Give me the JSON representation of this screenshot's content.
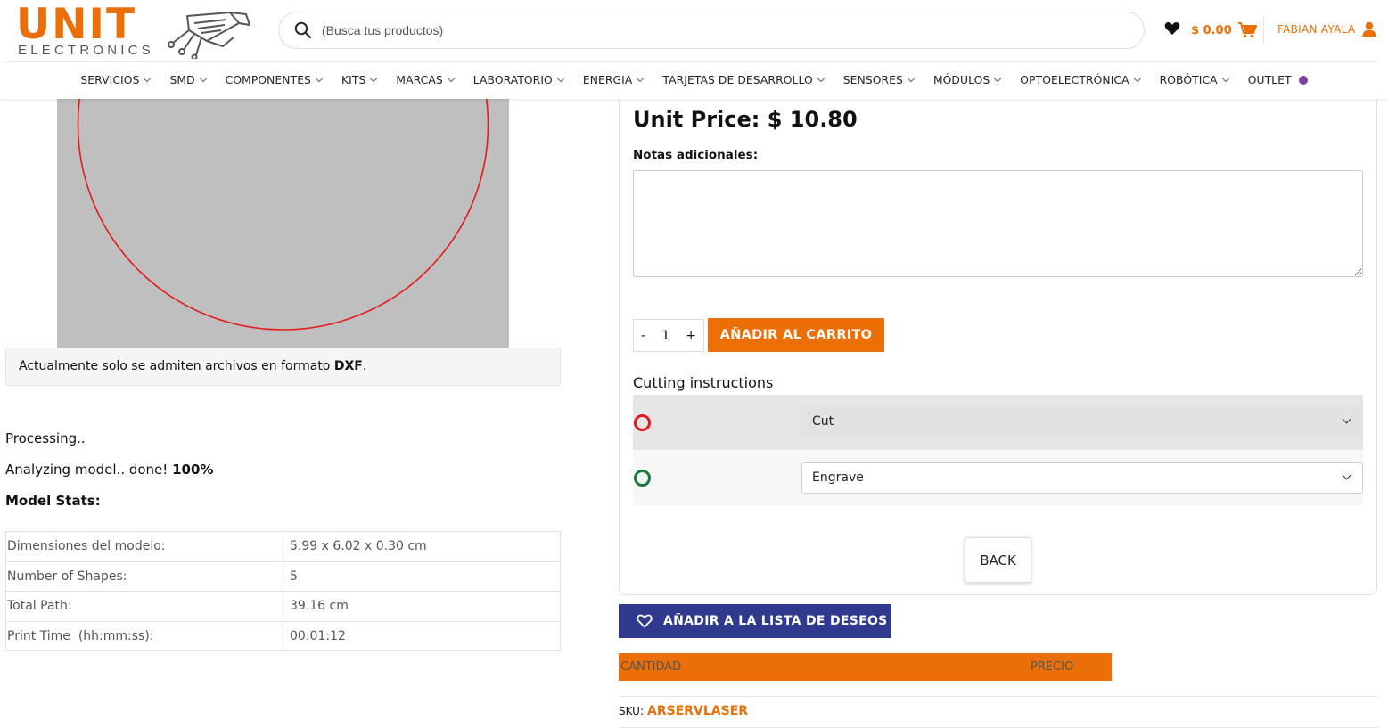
{
  "brand": {
    "name_top": "UNIT",
    "name_bottom": "ELECTRONICS",
    "accent": "#ec6e07",
    "logo_graphic": "circuit-connector-graphic"
  },
  "search": {
    "placeholder": "(Busca tus productos)",
    "icon": "search-icon"
  },
  "header": {
    "wishlist_icon": "heart-icon",
    "cart_total": "$ 0.00",
    "cart_icon": "cart-icon",
    "account_name": "FABIAN AYALA",
    "account_icon": "user-icon"
  },
  "nav": {
    "items": [
      {
        "label": "SERVICIOS",
        "dropdown": true
      },
      {
        "label": "SMD",
        "dropdown": true
      },
      {
        "label": "COMPONENTES",
        "dropdown": true
      },
      {
        "label": "KITS",
        "dropdown": true
      },
      {
        "label": "MARCAS",
        "dropdown": true
      },
      {
        "label": "LABORATORIO",
        "dropdown": true
      },
      {
        "label": "ENERGIA",
        "dropdown": true
      },
      {
        "label": "TARJETAS DE DESARROLLO",
        "dropdown": true
      },
      {
        "label": "SENSORES",
        "dropdown": true
      },
      {
        "label": "MÓDULOS",
        "dropdown": true
      },
      {
        "label": "OPTOELECTRÓNICA",
        "dropdown": true
      },
      {
        "label": "ROBÓTICA",
        "dropdown": true
      },
      {
        "label": "OUTLET",
        "dropdown": false
      }
    ]
  },
  "left": {
    "preview_bg": "#bfbfbf",
    "shape_color": "#e31b1b",
    "notice_text": "Actualmente solo se admiten archivos en formato ",
    "notice_format": "DXF",
    "notice_end": ".",
    "processing": "Processing..",
    "analyzing": "Analyzing model.. done! ",
    "analyzing_percent": "100%",
    "stats_title": "Model Stats:",
    "stats": [
      {
        "label": "Dimensiones del modelo:",
        "value": "5.99 x 6.02 x 0.30 cm"
      },
      {
        "label": "Number of Shapes:",
        "value": "5"
      },
      {
        "label": "Total Path:",
        "value": "39.16 cm"
      },
      {
        "label": "Print Time  (hh:mm:ss):",
        "value": "00:01:12"
      }
    ]
  },
  "right": {
    "unit_price": "Unit Price: $ 10.80",
    "notes_label": "Notas adicionales:",
    "qty_minus": "-",
    "qty_value": "1",
    "qty_plus": "+",
    "add_to_cart": "AÑADIR AL CARRITO",
    "cutting_title": "Cutting instructions",
    "cutting_rows": [
      {
        "color": "#e31b1b",
        "value": "Cut"
      },
      {
        "color": "#1a7a3c",
        "value": "Engrave"
      }
    ],
    "back": "BACK",
    "wishlist_button": "AÑADIR A LA LISTA DE DESEOS",
    "table_headers": [
      "CANTIDAD",
      "PRECIO"
    ],
    "sku_label": "SKU:",
    "sku_value": "ARSERVLASER",
    "wish_color": "#2f3a8f"
  }
}
